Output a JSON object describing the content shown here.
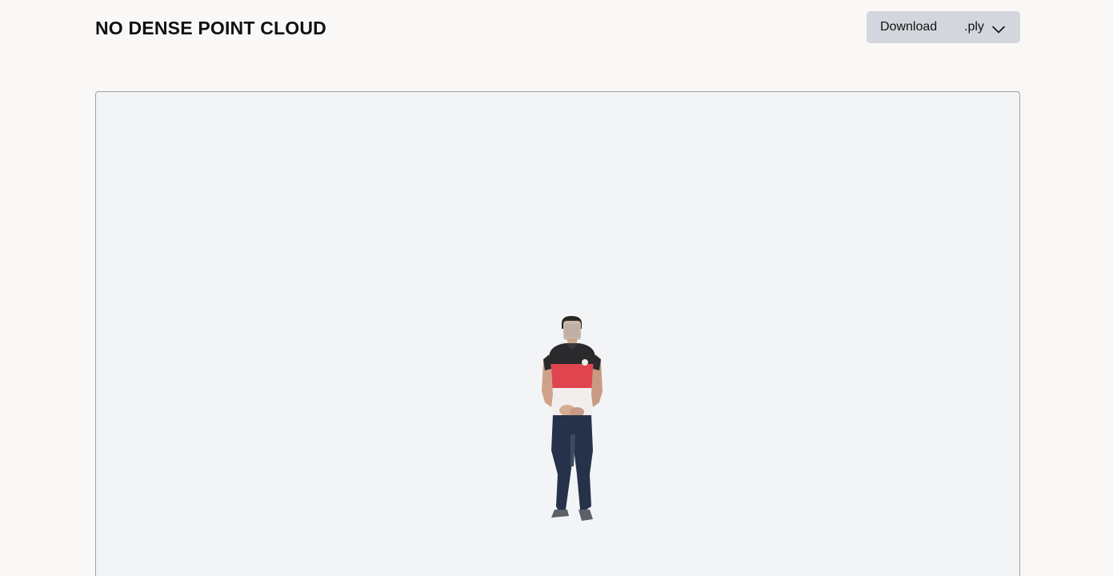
{
  "header": {
    "title": "NO DENSE POINT CLOUD"
  },
  "download": {
    "label": "Download",
    "format": ".ply"
  },
  "viewer": {
    "background": "#f3f4f6",
    "content": "point-cloud-person"
  },
  "colors": {
    "page_background": "#f9f8f6",
    "button_background": "#d4d6dd",
    "viewer_border": "#9ca0a8"
  }
}
